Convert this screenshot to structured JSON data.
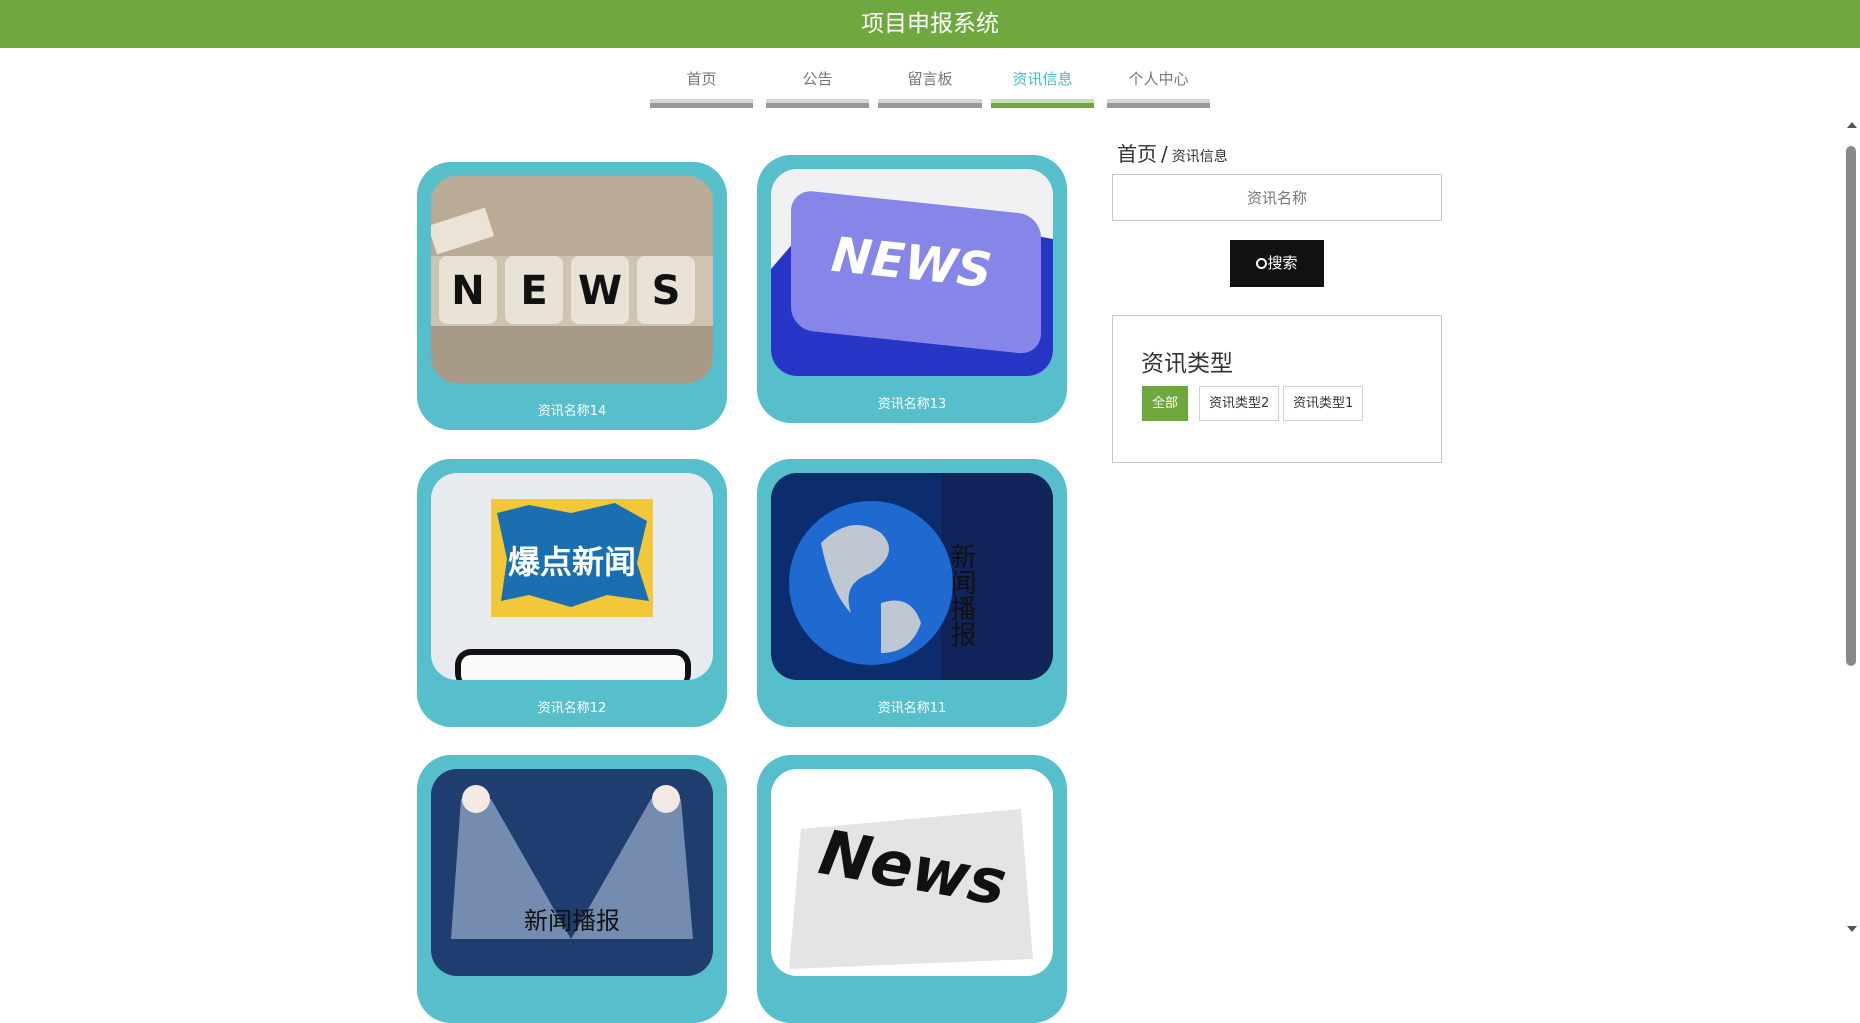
{
  "header": {
    "title": "项目申报系统"
  },
  "nav": [
    {
      "label": "首页",
      "active": false
    },
    {
      "label": "公告",
      "active": false
    },
    {
      "label": "留言板",
      "active": false
    },
    {
      "label": "资讯信息",
      "active": true
    },
    {
      "label": "个人中心",
      "active": false
    }
  ],
  "breadcrumb": {
    "home": "首页",
    "separator": "/",
    "current": "资讯信息"
  },
  "search": {
    "placeholder": "资讯名称",
    "button_label": "搜索",
    "icon": "search-icon"
  },
  "types": {
    "title": "资讯类型",
    "items": [
      {
        "label": "全部",
        "active": true
      },
      {
        "label": "资讯类型2",
        "active": false
      },
      {
        "label": "资讯类型1",
        "active": false
      }
    ]
  },
  "cards": [
    {
      "name": "资讯名称14"
    },
    {
      "name": "资讯名称13"
    },
    {
      "name": "资讯名称12",
      "image_text": "爆点新闻"
    },
    {
      "name": "资讯名称11",
      "image_text": "新闻播报"
    },
    {
      "name": "",
      "image_text": "新闻播报"
    },
    {
      "name": "",
      "image_text": "News"
    }
  ],
  "colors": {
    "header": "#70a840",
    "card": "#57bfcb",
    "nav_active": "#4bb8c8"
  }
}
